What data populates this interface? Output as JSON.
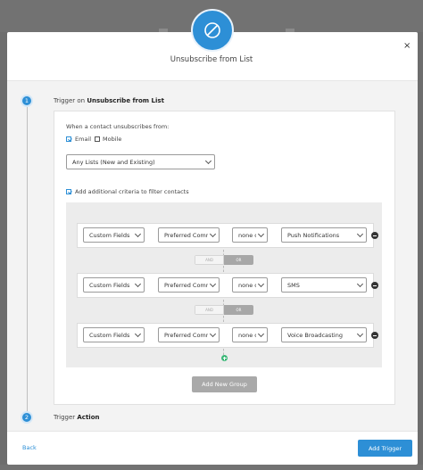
{
  "header": {
    "title": "Unsubscribe from List",
    "close": "×"
  },
  "steps": [
    {
      "number": "1",
      "prefix": "Trigger on ",
      "bold": "Unsubscribe from List"
    },
    {
      "number": "2",
      "prefix": "Trigger ",
      "bold": "Action"
    }
  ],
  "trigger": {
    "intro": "When a contact unsubscribes from:",
    "email_label": "Email",
    "mobile_label": "Mobile",
    "email_checked": true,
    "mobile_checked": false,
    "list_select": "Any Lists (New and Existing)",
    "criteria_label": "Add additional criteria to filter contacts",
    "criteria_checked": true
  },
  "rules": [
    {
      "field_type": "Custom Fields",
      "field": "Preferred Communication",
      "operator": "none of",
      "value": "Push Notifications"
    },
    {
      "field_type": "Custom Fields",
      "field": "Preferred Communication",
      "operator": "none of",
      "value": "SMS"
    },
    {
      "field_type": "Custom Fields",
      "field": "Preferred Communication",
      "operator": "none of",
      "value": "Voice Broadcasting"
    }
  ],
  "connectors": [
    {
      "and_label": "AND",
      "or_label": "OR",
      "selected": "OR"
    },
    {
      "and_label": "AND",
      "or_label": "OR",
      "selected": "OR"
    }
  ],
  "buttons": {
    "add_group": "Add New Group",
    "back": "Back",
    "add_trigger": "Add Trigger"
  },
  "colors": {
    "accent": "#2d8fd6",
    "add_condition": "#3cb878",
    "disabled_button": "#a9a9a9"
  }
}
